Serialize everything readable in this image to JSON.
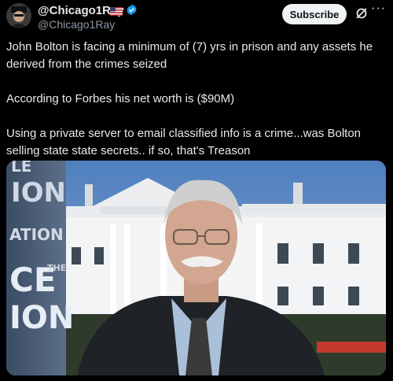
{
  "header": {
    "display_name": "@Chicago1Ray",
    "handle": "@Chicago1Ray",
    "subscribe_label": "Subscribe",
    "more_label": "···"
  },
  "tweet": {
    "paragraphs": [
      "John Bolton is facing a minimum of (7) yrs in prison and any assets he derived from the crimes seized",
      "According to Forbes his net worth is ($90M)",
      "Using a private server to email classified info is a crime...was Bolton selling state state secrets.. if so, that's Treason"
    ]
  },
  "media": {
    "banner_lines": [
      "LE",
      "ION",
      "ATION",
      "CE",
      "THE",
      "ION"
    ]
  },
  "colors": {
    "background": "#000000",
    "text": "#e7e9ea",
    "muted": "#8b98a5",
    "verified": "#1d9bf0",
    "subscribe_bg": "#eff3f4"
  },
  "icons": {
    "flag": "us-flag-icon",
    "verified": "verified-badge-icon",
    "grok": "grok-icon",
    "more": "more-icon"
  }
}
